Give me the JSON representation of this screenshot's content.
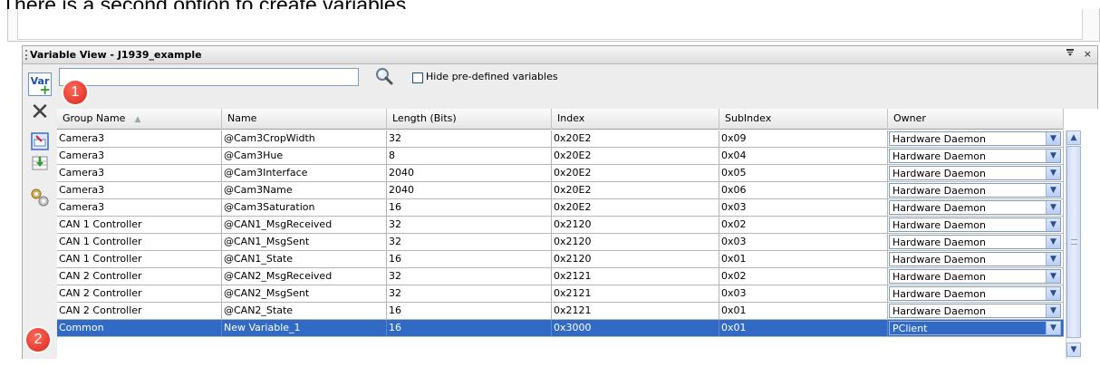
{
  "caption": "There is a second option to create variables.",
  "panel": {
    "title": "Variable View - J1939_example",
    "pin_icon": "pin-icon",
    "close_label": "×"
  },
  "search": {
    "value": "",
    "placeholder": ""
  },
  "filter": {
    "hide_predefined_label": "Hide pre-defined variables",
    "checked": false
  },
  "toolbar": {
    "buttons": [
      "add-variable-icon",
      "delete-icon",
      "edit-icon",
      "import-icon",
      "settings-icon"
    ],
    "add_label": "Var",
    "delete_glyph": "✕"
  },
  "badges": [
    "1",
    "2"
  ],
  "columns": [
    "Group Name",
    "Name",
    "Length (Bits)",
    "Index",
    "SubIndex",
    "Owner"
  ],
  "rows": [
    {
      "group": "Camera3",
      "name": "@Cam3CropWidth",
      "length": "32",
      "index": "0x20E2",
      "subindex": "0x09",
      "owner": "Hardware Daemon"
    },
    {
      "group": "Camera3",
      "name": "@Cam3Hue",
      "length": "8",
      "index": "0x20E2",
      "subindex": "0x04",
      "owner": "Hardware Daemon"
    },
    {
      "group": "Camera3",
      "name": "@Cam3Interface",
      "length": "2040",
      "index": "0x20E2",
      "subindex": "0x05",
      "owner": "Hardware Daemon"
    },
    {
      "group": "Camera3",
      "name": "@Cam3Name",
      "length": "2040",
      "index": "0x20E2",
      "subindex": "0x06",
      "owner": "Hardware Daemon"
    },
    {
      "group": "Camera3",
      "name": "@Cam3Saturation",
      "length": "16",
      "index": "0x20E2",
      "subindex": "0x03",
      "owner": "Hardware Daemon"
    },
    {
      "group": "CAN 1 Controller",
      "name": "@CAN1_MsgReceived",
      "length": "32",
      "index": "0x2120",
      "subindex": "0x02",
      "owner": "Hardware Daemon"
    },
    {
      "group": "CAN 1 Controller",
      "name": "@CAN1_MsgSent",
      "length": "32",
      "index": "0x2120",
      "subindex": "0x03",
      "owner": "Hardware Daemon"
    },
    {
      "group": "CAN 1 Controller",
      "name": "@CAN1_State",
      "length": "16",
      "index": "0x2120",
      "subindex": "0x01",
      "owner": "Hardware Daemon"
    },
    {
      "group": "CAN 2 Controller",
      "name": "@CAN2_MsgReceived",
      "length": "32",
      "index": "0x2121",
      "subindex": "0x02",
      "owner": "Hardware Daemon"
    },
    {
      "group": "CAN 2 Controller",
      "name": "@CAN2_MsgSent",
      "length": "32",
      "index": "0x2121",
      "subindex": "0x03",
      "owner": "Hardware Daemon"
    },
    {
      "group": "CAN 2 Controller",
      "name": "@CAN2_State",
      "length": "16",
      "index": "0x2121",
      "subindex": "0x01",
      "owner": "Hardware Daemon"
    },
    {
      "group": "Common",
      "name": "New Variable_1",
      "length": "16",
      "index": "0x3000",
      "subindex": "0x01",
      "owner": "PClient",
      "selected": true
    }
  ],
  "colors": {
    "selection": "#316ac5",
    "badge": "#d9261b",
    "accent": "#7f9db9"
  }
}
